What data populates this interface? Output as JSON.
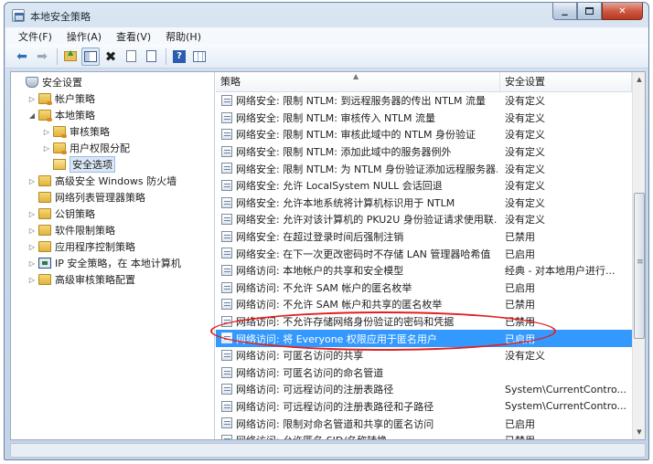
{
  "window": {
    "title": "本地安全策略"
  },
  "window_buttons": {
    "minimize": "▁",
    "close": "✕"
  },
  "menu": [
    "文件(F)",
    "操作(A)",
    "查看(V)",
    "帮助(H)"
  ],
  "toolbar_icons": [
    "back-arrow-icon",
    "forward-arrow-icon",
    "up-folder-icon",
    "show-hide-tree-icon",
    "delete-icon",
    "properties-icon",
    "export-icon",
    "help-icon",
    "details-view-icon"
  ],
  "tree": [
    {
      "label": "安全设置",
      "icon": "shield-icon",
      "expander": "",
      "indent": 0
    },
    {
      "label": "帐户策略",
      "icon": "folder-icon",
      "expander": "▷",
      "indent": 1
    },
    {
      "label": "本地策略",
      "icon": "folder-icon",
      "expander": "◢",
      "indent": 1
    },
    {
      "label": "审核策略",
      "icon": "folder-icon",
      "expander": "▷",
      "indent": 2
    },
    {
      "label": "用户权限分配",
      "icon": "folder-icon",
      "expander": "▷",
      "indent": 2
    },
    {
      "label": "安全选项",
      "icon": "folder-open-icon",
      "expander": "",
      "indent": 2,
      "selected": true
    },
    {
      "label": "高级安全 Windows 防火墙",
      "icon": "folder-icon",
      "expander": "▷",
      "indent": 1
    },
    {
      "label": "网络列表管理器策略",
      "icon": "folder-icon",
      "expander": "",
      "indent": 1
    },
    {
      "label": "公钥策略",
      "icon": "folder-icon",
      "expander": "▷",
      "indent": 1
    },
    {
      "label": "软件限制策略",
      "icon": "folder-icon",
      "expander": "▷",
      "indent": 1
    },
    {
      "label": "应用程序控制策略",
      "icon": "folder-icon",
      "expander": "▷",
      "indent": 1
    },
    {
      "label": "IP 安全策略，在 本地计算机",
      "icon": "network-icon",
      "expander": "▷",
      "indent": 1
    },
    {
      "label": "高级审核策略配置",
      "icon": "folder-icon",
      "expander": "▷",
      "indent": 1
    }
  ],
  "list": {
    "columns": {
      "policy": "策略",
      "setting": "安全设置"
    },
    "rows": [
      {
        "policy": "网络安全: 限制 NTLM: 到远程服务器的传出 NTLM 流量",
        "setting": "没有定义"
      },
      {
        "policy": "网络安全: 限制 NTLM: 审核传入 NTLM 流量",
        "setting": "没有定义"
      },
      {
        "policy": "网络安全: 限制 NTLM: 审核此域中的 NTLM 身份验证",
        "setting": "没有定义"
      },
      {
        "policy": "网络安全: 限制 NTLM: 添加此域中的服务器例外",
        "setting": "没有定义"
      },
      {
        "policy": "网络安全: 限制 NTLM: 为 NTLM 身份验证添加远程服务器...",
        "setting": "没有定义"
      },
      {
        "policy": "网络安全: 允许 LocalSystem NULL 会话回退",
        "setting": "没有定义"
      },
      {
        "policy": "网络安全: 允许本地系统将计算机标识用于 NTLM",
        "setting": "没有定义"
      },
      {
        "policy": "网络安全: 允许对该计算机的 PKU2U 身份验证请求使用联...",
        "setting": "没有定义"
      },
      {
        "policy": "网络安全: 在超过登录时间后强制注销",
        "setting": "已禁用"
      },
      {
        "policy": "网络安全: 在下一次更改密码时不存储 LAN 管理器哈希值",
        "setting": "已启用"
      },
      {
        "policy": "网络访问: 本地帐户的共享和安全模型",
        "setting": "经典 - 对本地用户进行..."
      },
      {
        "policy": "网络访问: 不允许 SAM 帐户的匿名枚举",
        "setting": "已启用"
      },
      {
        "policy": "网络访问: 不允许 SAM 帐户和共享的匿名枚举",
        "setting": "已禁用"
      },
      {
        "policy": "网络访问: 不允许存储网络身份验证的密码和凭据",
        "setting": "已禁用"
      },
      {
        "policy": "网络访问: 将 Everyone 权限应用于匿名用户",
        "setting": "已启用",
        "selected": true
      },
      {
        "policy": "网络访问: 可匿名访问的共享",
        "setting": "没有定义"
      },
      {
        "policy": "网络访问: 可匿名访问的命名管道",
        "setting": ""
      },
      {
        "policy": "网络访问: 可远程访问的注册表路径",
        "setting": "System\\CurrentContro..."
      },
      {
        "policy": "网络访问: 可远程访问的注册表路径和子路径",
        "setting": "System\\CurrentContro..."
      },
      {
        "policy": "网络访问: 限制对命名管道和共享的匿名访问",
        "setting": "已启用"
      },
      {
        "policy": "网络访问: 允许匿名 SID/名称转换",
        "setting": "已禁用"
      }
    ]
  },
  "scrollbar": {
    "position": 0.55
  }
}
